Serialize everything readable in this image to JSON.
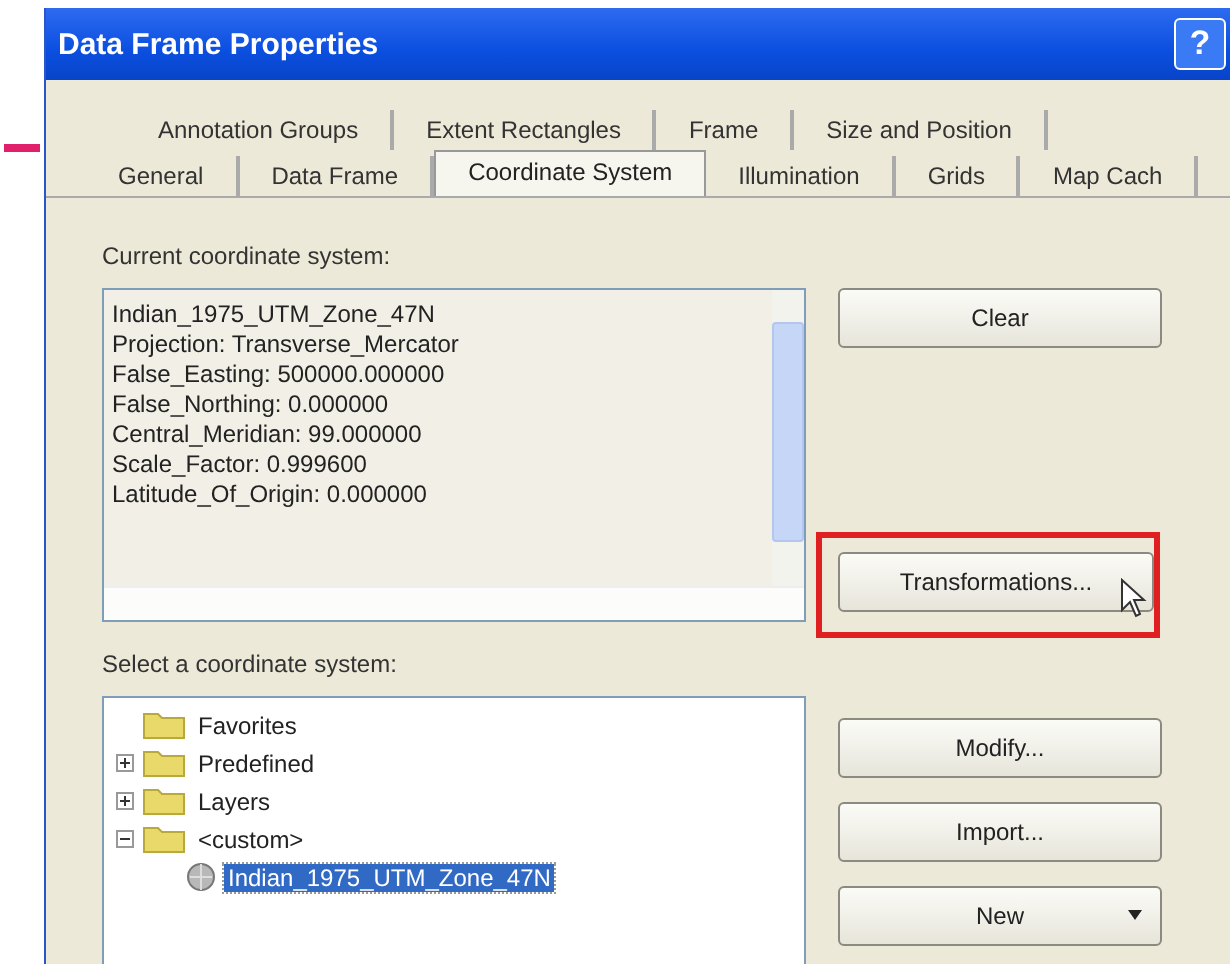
{
  "window": {
    "title": "Data Frame Properties",
    "help_button": "?"
  },
  "tab_rows": [
    [
      {
        "label": "Annotation Groups",
        "selected": false
      },
      {
        "label": "Extent Rectangles",
        "selected": false
      },
      {
        "label": "Frame",
        "selected": false
      },
      {
        "label": "Size and Position",
        "selected": false
      }
    ],
    [
      {
        "label": "General",
        "selected": false
      },
      {
        "label": "Data Frame",
        "selected": false
      },
      {
        "label": "Coordinate System",
        "selected": true
      },
      {
        "label": "Illumination",
        "selected": false
      },
      {
        "label": "Grids",
        "selected": false
      },
      {
        "label": "Map Cach",
        "selected": false
      }
    ]
  ],
  "current": {
    "label": "Current coordinate system:",
    "lines": [
      "Indian_1975_UTM_Zone_47N",
      "Projection: Transverse_Mercator",
      "False_Easting: 500000.000000",
      "False_Northing: 0.000000",
      "Central_Meridian: 99.000000",
      "Scale_Factor: 0.999600",
      "Latitude_Of_Origin: 0.000000"
    ]
  },
  "buttons_top": [
    {
      "label": "Clear",
      "highlighted": false
    },
    {
      "label": "Transformations...",
      "highlighted": true
    }
  ],
  "select": {
    "label": "Select a coordinate system:",
    "tree": [
      {
        "label": "Favorites",
        "kind": "folder"
      },
      {
        "label": "Predefined",
        "kind": "folder",
        "expanded": false
      },
      {
        "label": "Layers",
        "kind": "folder",
        "expanded": false
      },
      {
        "label": "<custom>",
        "kind": "folder",
        "expanded": true,
        "children": [
          {
            "label": "Indian_1975_UTM_Zone_47N",
            "kind": "system",
            "selected": true
          }
        ]
      }
    ]
  },
  "buttons_bottom": [
    {
      "label": "Modify...",
      "kind": "plain"
    },
    {
      "label": "Import...",
      "kind": "plain"
    },
    {
      "label": "New",
      "kind": "dropdown"
    }
  ]
}
